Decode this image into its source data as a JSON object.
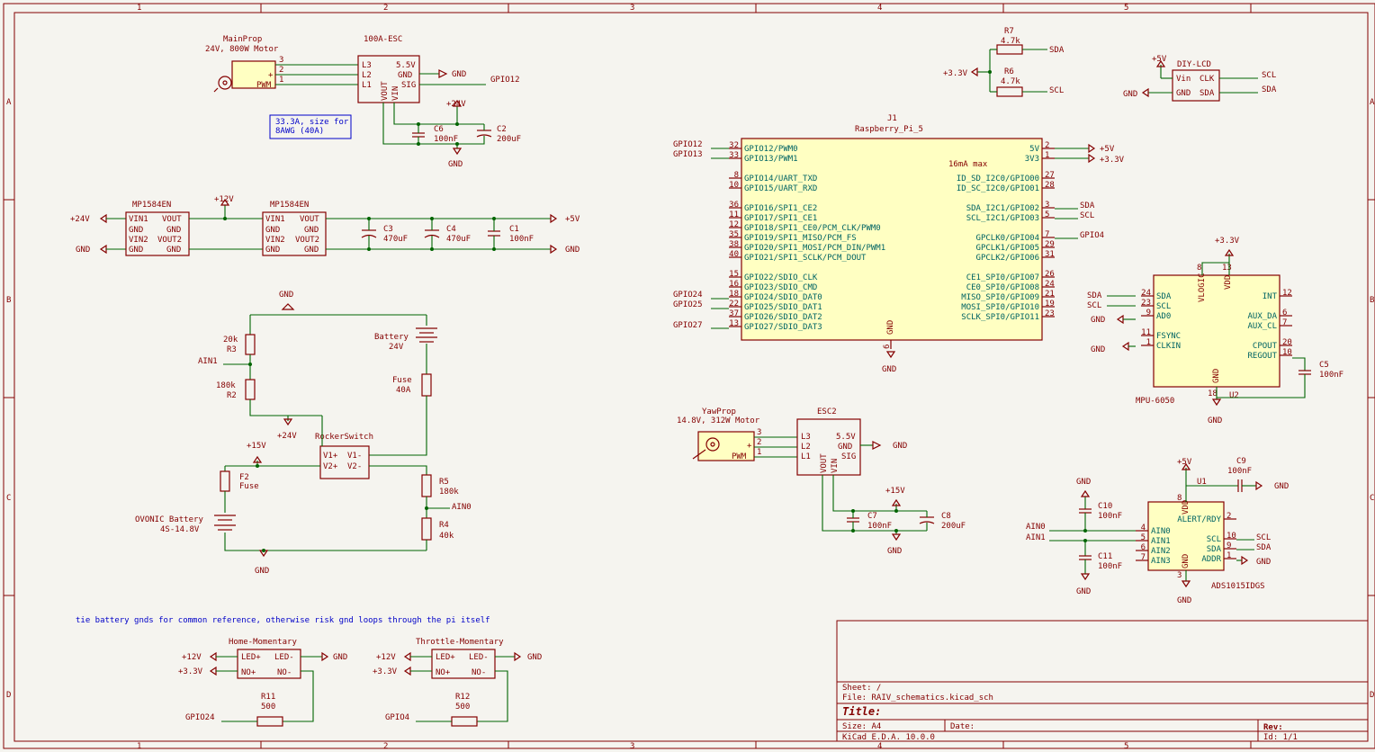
{
  "sheet": {
    "columns": [
      "1",
      "2",
      "3",
      "4",
      "5"
    ],
    "rows": [
      "A",
      "B",
      "C",
      "D"
    ]
  },
  "title_block": {
    "sheet": "Sheet: /",
    "file": "File: RAIV_schematics.kicad_sch",
    "title": "Title:",
    "size": "Size: A4",
    "date": "Date:",
    "rev": "Rev:",
    "tool": "KiCad E.D.A. 10.0.0",
    "id": "Id: 1/1"
  },
  "notes": {
    "awg": [
      "33.3A, size for",
      "8AWG (40A)"
    ],
    "gnd_tie": "tie battery gnds for common reference, otherwise risk gnd loops through the pi itself",
    "current": "16mA max"
  },
  "main_motor": {
    "ref": "MainProp",
    "value": "24V, 800W Motor",
    "pins": [
      "3",
      "2",
      "1"
    ],
    "pwm": "PWM",
    "plus": "+"
  },
  "esc1": {
    "ref": "100A-ESC",
    "left": [
      "L3",
      "L2",
      "L1"
    ],
    "right": [
      "5.5V",
      "GND",
      "SIG"
    ],
    "bottom": [
      "VOUT",
      "VIN"
    ]
  },
  "yaw_motor": {
    "ref": "YawProp",
    "value": "14.8V, 312W Motor",
    "pins": [
      "3",
      "2",
      "1"
    ],
    "pwm": "PWM",
    "plus": "+"
  },
  "esc2": {
    "ref": "ESC2",
    "left": [
      "L3",
      "L2",
      "L1"
    ],
    "right": [
      "5.5V",
      "GND",
      "SIG"
    ],
    "bottom": [
      "VOUT",
      "VIN"
    ]
  },
  "buck": {
    "ref": "MP1584EN",
    "left": [
      "VIN1",
      "GND",
      "VIN2",
      "GND"
    ],
    "right": [
      "VOUT",
      "GND",
      "VOUT2",
      "GND"
    ]
  },
  "pi": {
    "ref": "J1",
    "value": "Raspberry_Pi_5",
    "left": [
      {
        "pin": "32",
        "name": "GPIO12/PWM0"
      },
      {
        "pin": "33",
        "name": "GPIO13/PWM1"
      },
      {
        "pin": "8",
        "name": "GPIO14/UART_TXD"
      },
      {
        "pin": "10",
        "name": "GPIO15/UART_RXD"
      },
      {
        "pin": "36",
        "name": "GPIO16/SPI1_CE2"
      },
      {
        "pin": "11",
        "name": "GPIO17/SPI1_CE1"
      },
      {
        "pin": "12",
        "name": "GPIO18/SPI1_CE0/PCM_CLK/PWM0"
      },
      {
        "pin": "35",
        "name": "GPIO19/SPI1_MISO/PCM_FS"
      },
      {
        "pin": "38",
        "name": "GPIO20/SPI1_MOSI/PCM_DIN/PWM1"
      },
      {
        "pin": "40",
        "name": "GPIO21/SPI1_SCLK/PCM_DOUT"
      },
      {
        "pin": "15",
        "name": "GPIO22/SDIO_CLK"
      },
      {
        "pin": "16",
        "name": "GPIO23/SDIO_CMD"
      },
      {
        "pin": "18",
        "name": "GPIO24/SDIO_DAT0"
      },
      {
        "pin": "22",
        "name": "GPIO25/SDIO_DAT1"
      },
      {
        "pin": "37",
        "name": "GPIO26/SDIO_DAT2"
      },
      {
        "pin": "13",
        "name": "GPIO27/SDIO_DAT3"
      }
    ],
    "right": [
      {
        "pin": "2",
        "name": "5V"
      },
      {
        "pin": "1",
        "name": "3V3"
      },
      {
        "pin": "27",
        "name": "ID_SD_I2C0/GPIO00"
      },
      {
        "pin": "28",
        "name": "ID_SC_I2C0/GPIO01"
      },
      {
        "pin": "3",
        "name": "SDA_I2C1/GPIO02"
      },
      {
        "pin": "5",
        "name": "SCL_I2C1/GPIO03"
      },
      {
        "pin": "7",
        "name": "GPCLK0/GPIO04"
      },
      {
        "pin": "29",
        "name": "GPCLK1/GPIO05"
      },
      {
        "pin": "31",
        "name": "GPCLK2/GPIO06"
      },
      {
        "pin": "26",
        "name": "CE1_SPI0/GPIO07"
      },
      {
        "pin": "24",
        "name": "CE0_SPI0/GPIO08"
      },
      {
        "pin": "21",
        "name": "MISO_SPI0/GPIO09"
      },
      {
        "pin": "19",
        "name": "MOSI_SPI0/GPIO10"
      },
      {
        "pin": "23",
        "name": "SCLK_SPI0/GPIO11"
      }
    ],
    "gnd_pin": "6",
    "gnd": "GND"
  },
  "mpu": {
    "ref": "U2",
    "value": "MPU-6050",
    "left": [
      {
        "pin": "24",
        "name": "SDA"
      },
      {
        "pin": "23",
        "name": "SCL"
      },
      {
        "pin": "9",
        "name": "AD0"
      },
      {
        "pin": "11",
        "name": "FSYNC"
      },
      {
        "pin": "1",
        "name": "CLKIN"
      }
    ],
    "right": [
      {
        "pin": "12",
        "name": "INT"
      },
      {
        "pin": "6",
        "name": "AUX_DA"
      },
      {
        "pin": "7",
        "name": "AUX_CL"
      },
      {
        "pin": "20",
        "name": "CPOUT"
      },
      {
        "pin": "10",
        "name": "REGOUT"
      }
    ],
    "top": [
      {
        "pin": "8",
        "name": "VLOGIC"
      },
      {
        "pin": "13",
        "name": "VDD"
      }
    ],
    "bottom": {
      "pin": "18",
      "name": "GND"
    }
  },
  "adc": {
    "ref": "U1",
    "value": "ADS1015IDGS",
    "left": [
      {
        "pin": "4",
        "name": "AIN0"
      },
      {
        "pin": "5",
        "name": "AIN1"
      },
      {
        "pin": "6",
        "name": "AIN2"
      },
      {
        "pin": "7",
        "name": "AIN3"
      }
    ],
    "right": [
      {
        "pin": "2",
        "name": "ALERT/RDY"
      },
      {
        "pin": "10",
        "name": "SCL"
      },
      {
        "pin": "9",
        "name": "SDA"
      },
      {
        "pin": "1",
        "name": "ADDR"
      }
    ],
    "top": {
      "pin": "8",
      "name": "VDD"
    },
    "bottom": {
      "pin": "3",
      "name": "GND"
    }
  },
  "lcd": {
    "ref": "DIY-LCD",
    "left": [
      "Vin",
      "GND"
    ],
    "right": [
      "CLK",
      "SDA"
    ]
  },
  "rocker": {
    "ref": "RockerSwitch",
    "left": [
      "V1+",
      "V2+"
    ],
    "right": [
      "V1-",
      "V2-"
    ]
  },
  "buttons": [
    {
      "ref": "Home-Momentary",
      "pins": [
        "LED+",
        "LED-",
        "NO+",
        "NO-"
      ],
      "res_ref": "R11",
      "res_val": "500",
      "gpio": "GPIO24"
    },
    {
      "ref": "Throttle-Momentary",
      "pins": [
        "LED+",
        "LED-",
        "NO+",
        "NO-"
      ],
      "res_ref": "R12",
      "res_val": "500",
      "gpio": "GPIO4"
    }
  ],
  "parts": {
    "C6": "100nF",
    "C2": "200uF",
    "C3": "470uF",
    "C4": "470uF",
    "C1": "100nF",
    "C7": "100nF",
    "C8": "200uF",
    "C5": "100nF",
    "C9": "100nF",
    "C10": "100nF",
    "C11": "100nF",
    "R7": "4.7k",
    "R6": "4.7k",
    "R3": "20k",
    "R2": "180k",
    "R5": "180k",
    "R4": "40k",
    "F1": "40A",
    "F1_name": "Fuse",
    "F2": "F2",
    "F2_name": "Fuse",
    "BT1": "Battery",
    "BT1_val": "24V",
    "BT2": "OVONIC Battery",
    "BT2_val": "4S-14.8V"
  },
  "nets": {
    "gnd": "GND",
    "p24": "+24V",
    "p12": "+12V",
    "p5": "+5V",
    "p33": "+3.3V",
    "p15": "+15V",
    "sda": "SDA",
    "scl": "SCL",
    "ain0": "AIN0",
    "ain1": "AIN1",
    "gpio12": "GPIO12",
    "gpio13": "GPIO13",
    "gpio24": "GPIO24",
    "gpio25": "GPIO25",
    "gpio27": "GPIO27",
    "gpio4": "GPIO4"
  }
}
